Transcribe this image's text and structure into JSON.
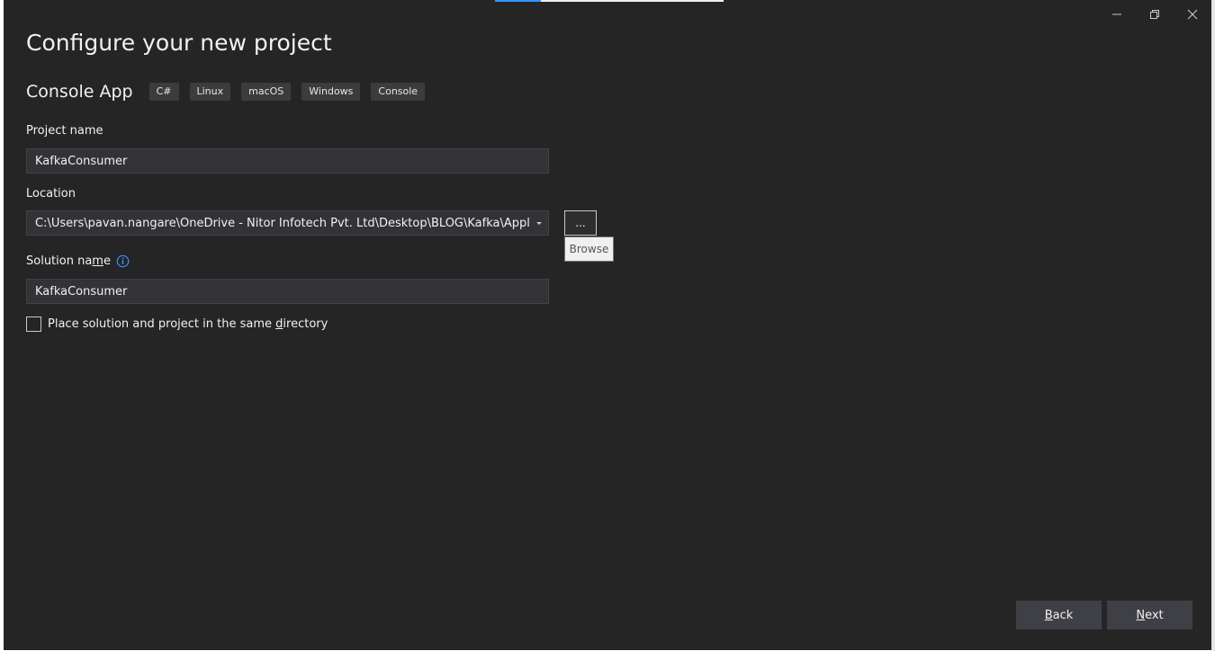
{
  "window": {
    "title": "Configure your new project",
    "progress_percent": 20,
    "controls": {
      "minimize_icon": "minimize-icon",
      "restore_icon": "restore-icon",
      "close_icon": "close-icon"
    }
  },
  "template": {
    "name": "Console App",
    "tags": [
      "C#",
      "Linux",
      "macOS",
      "Windows",
      "Console"
    ]
  },
  "project_name": {
    "label": "Project name",
    "value": "KafkaConsumer"
  },
  "location": {
    "label": "Location",
    "value": "C:\\Users\\pavan.nangare\\OneDrive - Nitor Infotech Pvt. Ltd\\Desktop\\BLOG\\Kafka\\Application\\",
    "browse_label": "...",
    "tooltip": "Browse"
  },
  "solution_name": {
    "label_before": "Solution na",
    "label_access": "m",
    "label_after": "e",
    "value": "KafkaConsumer"
  },
  "same_directory": {
    "label_before": "Place solution and project in the same ",
    "label_access": "d",
    "label_after": "irectory",
    "checked": false
  },
  "footer": {
    "back_access": "B",
    "back_rest": "ack",
    "next_access": "N",
    "next_rest": "ext"
  },
  "colors": {
    "background": "#252526",
    "accent": "#3794ff"
  }
}
